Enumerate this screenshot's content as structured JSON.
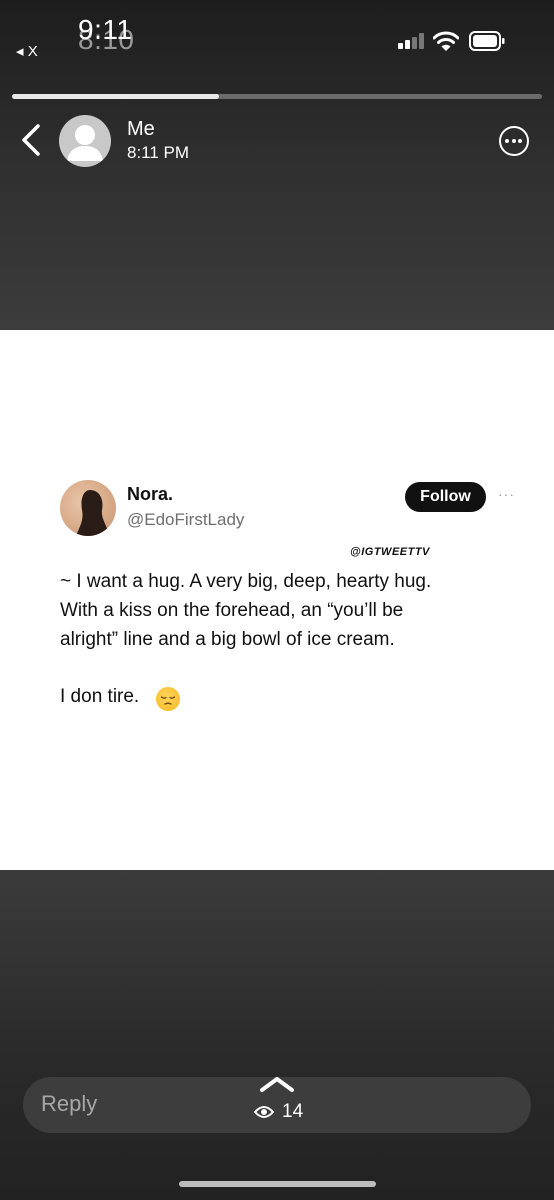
{
  "status_bar": {
    "time": "9:11",
    "time_shadow": "8:10",
    "back_app": "◂ X"
  },
  "story": {
    "progress": 0.39,
    "poster_name": "Me",
    "post_time": "8:11 PM"
  },
  "tweet": {
    "name": "Nora.",
    "handle": "@EdoFirstLady",
    "follow_label": "Follow",
    "more": "···",
    "watermark": "@IGTWEETTV",
    "lines": [
      "~ I want a hug. A very big, deep, hearty hug.",
      "With a kiss on the forehead, an “you’ll be",
      "alright” line and a big bowl of ice cream."
    ],
    "last_line": "I don tire."
  },
  "footer": {
    "reply_placeholder": "Reply",
    "views": "14"
  },
  "colors": {
    "background": "#3b3b3b",
    "reply_field": "#3d3d3d",
    "follow_button": "#111111"
  },
  "icons": [
    "back-chevron-icon",
    "more-icon",
    "signal-icon",
    "wifi-icon",
    "battery-icon",
    "chevron-up-icon",
    "eye-icon",
    "pensive-face-emoji"
  ]
}
